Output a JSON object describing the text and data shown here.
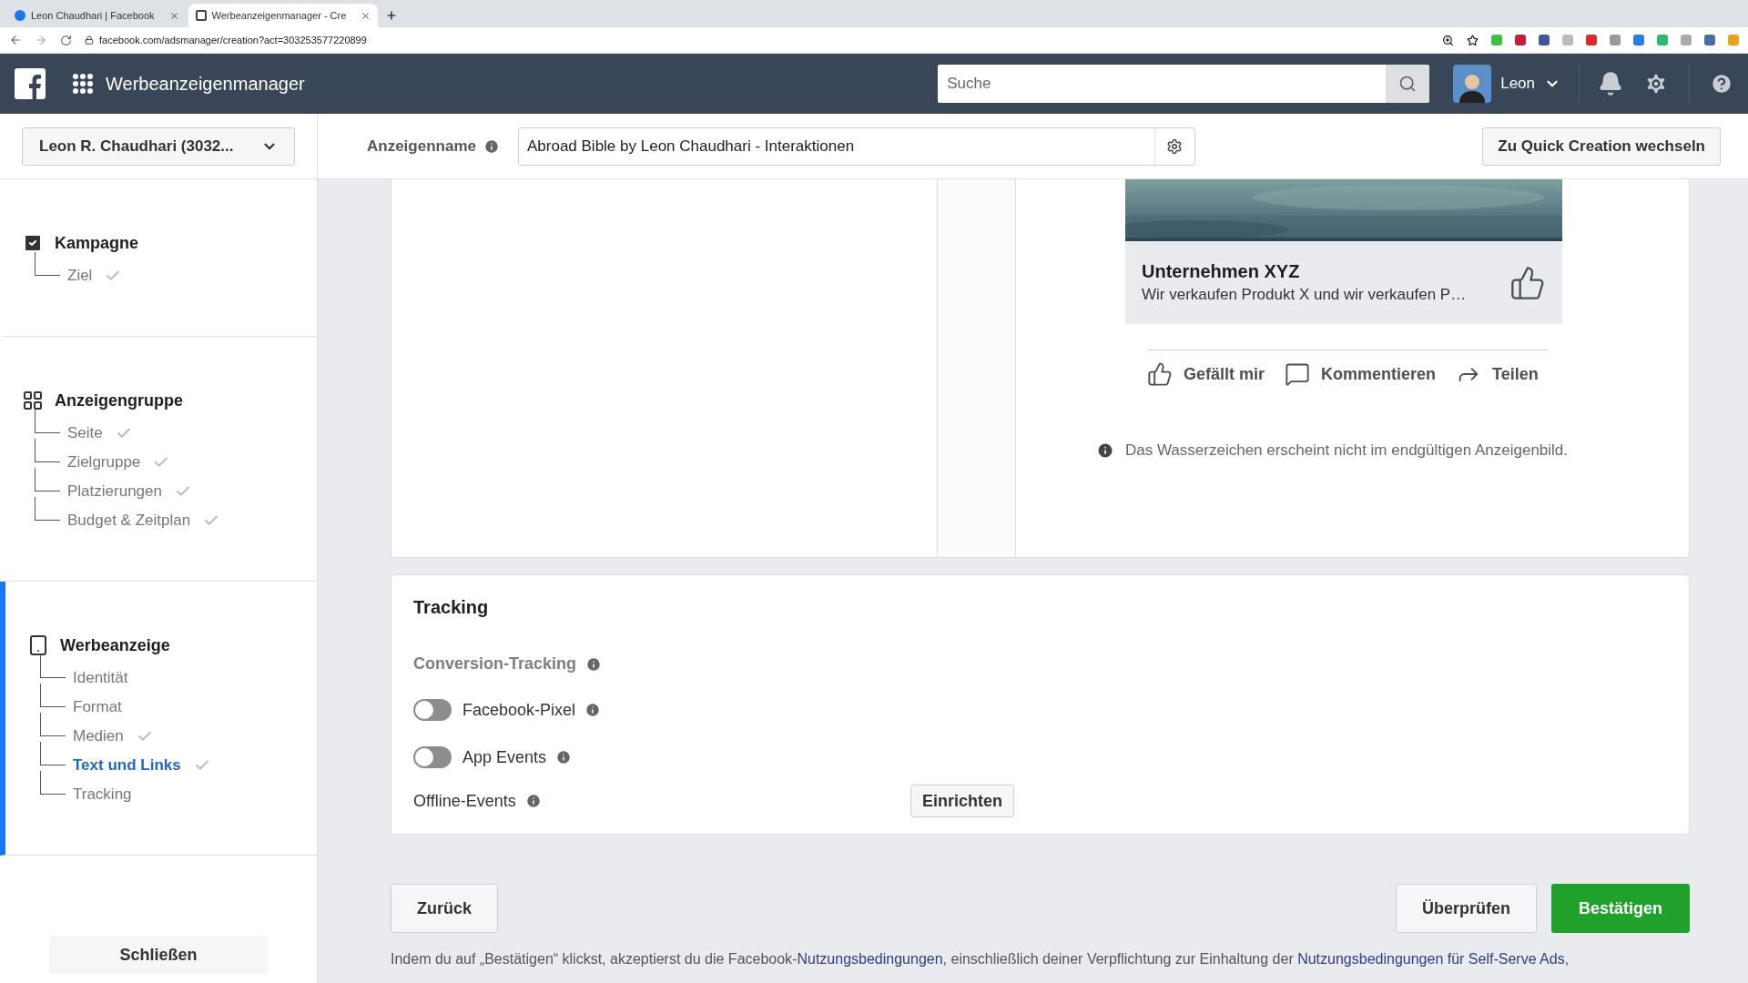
{
  "browser": {
    "tabs": [
      {
        "title": "Leon Chaudhari | Facebook",
        "selected": false
      },
      {
        "title": "Werbeanzeigenmanager - Cre",
        "selected": true
      }
    ],
    "url": "facebook.com/adsmanager/creation?act=303253577220899"
  },
  "header": {
    "app_title": "Werbeanzeigenmanager",
    "search": {
      "placeholder": "Suche"
    },
    "user_name": "Leon"
  },
  "toolbar": {
    "account": "Leon R. Chaudhari (3032...",
    "ad_name_label": "Anzeigenname",
    "ad_name_value": "Abroad Bible by Leon Chaudhari - Interaktionen",
    "quick_creation": "Zu Quick Creation wechseln"
  },
  "sidebar": {
    "sections": [
      {
        "title": "Kampagne",
        "kind": "campaign",
        "selected": false,
        "items": [
          {
            "label": "Ziel",
            "done": true,
            "selected": false
          }
        ]
      },
      {
        "title": "Anzeigengruppe",
        "kind": "adset",
        "selected": false,
        "items": [
          {
            "label": "Seite",
            "done": true,
            "selected": false
          },
          {
            "label": "Zielgruppe",
            "done": true,
            "selected": false
          },
          {
            "label": "Platzierungen",
            "done": true,
            "selected": false
          },
          {
            "label": "Budget & Zeitplan",
            "done": true,
            "selected": false
          }
        ]
      },
      {
        "title": "Werbeanzeige",
        "kind": "ad",
        "selected": true,
        "items": [
          {
            "label": "Identität",
            "done": false,
            "selected": false
          },
          {
            "label": "Format",
            "done": false,
            "selected": false
          },
          {
            "label": "Medien",
            "done": true,
            "selected": false
          },
          {
            "label": "Text und Links",
            "done": true,
            "selected": true
          },
          {
            "label": "Tracking",
            "done": false,
            "selected": false
          }
        ]
      }
    ],
    "close_button": "Schließen"
  },
  "preview": {
    "company": "Unternehmen XYZ",
    "description": "Wir verkaufen Produkt X und wir verkaufen P…",
    "actions": [
      {
        "label": "Gefällt mir",
        "kind": "like"
      },
      {
        "label": "Kommentieren",
        "kind": "comment"
      },
      {
        "label": "Teilen",
        "kind": "share"
      }
    ],
    "note": "Das Wasserzeichen erscheint nicht im endgültigen Anzeigenbild."
  },
  "tracking": {
    "title": "Tracking",
    "conversion_label": "Conversion-Tracking",
    "toggles": [
      {
        "label": "Facebook-Pixel",
        "on": false
      },
      {
        "label": "App Events",
        "on": false
      }
    ],
    "offline_label": "Offline-Events",
    "setup_button": "Einrichten"
  },
  "footer": {
    "back": "Zurück",
    "review": "Überprüfen",
    "confirm": "Bestätigen",
    "legal": [
      {
        "text": "Indem du auf „Bestätigen“ klickst, akzeptierst du die Facebook-",
        "link": false
      },
      {
        "text": "Nutzungsbedingungen",
        "link": true
      },
      {
        "text": ", einschließlich deiner Verpflichtung zur Einhaltung der ",
        "link": false
      },
      {
        "text": "Nutzungsbedingungen für Self-Serve Ads",
        "link": true
      },
      {
        "text": ",",
        "link": false
      }
    ]
  }
}
